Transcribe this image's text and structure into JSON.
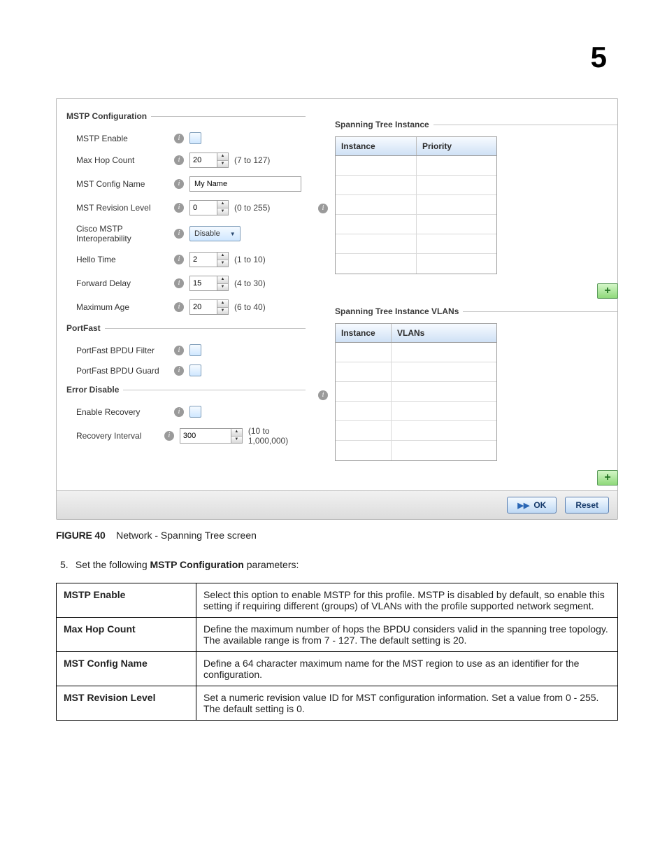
{
  "chapter_number": "5",
  "mstp_config": {
    "title": "MSTP Configuration",
    "rows": {
      "mstp_enable": {
        "label": "MSTP Enable"
      },
      "max_hop": {
        "label": "Max Hop Count",
        "value": "20",
        "hint": "(7 to 127)"
      },
      "config_name": {
        "label": "MST Config Name",
        "value": "My Name"
      },
      "rev_level": {
        "label": "MST Revision Level",
        "value": "0",
        "hint": "(0 to 255)"
      },
      "cisco": {
        "label": "Cisco MSTP Interoperability",
        "value": "Disable"
      },
      "hello": {
        "label": "Hello Time",
        "value": "2",
        "hint": "(1 to 10)"
      },
      "fwd_delay": {
        "label": "Forward Delay",
        "value": "15",
        "hint": "(4 to 30)"
      },
      "max_age": {
        "label": "Maximum Age",
        "value": "20",
        "hint": "(6 to 40)"
      }
    }
  },
  "portfast": {
    "title": "PortFast",
    "filter": {
      "label": "PortFast BPDU Filter"
    },
    "guard": {
      "label": "PortFast BPDU Guard"
    }
  },
  "error_disable": {
    "title": "Error Disable",
    "enable_recovery": {
      "label": "Enable Recovery"
    },
    "recovery_interval": {
      "label": "Recovery Interval",
      "value": "300",
      "hint": "(10 to 1,000,000)"
    }
  },
  "sti": {
    "title": "Spanning Tree Instance",
    "col_instance": "Instance",
    "col_priority": "Priority"
  },
  "stiv": {
    "title": "Spanning Tree Instance VLANs",
    "col_instance": "Instance",
    "col_vlans": "VLANs"
  },
  "buttons": {
    "ok": "OK",
    "reset": "Reset"
  },
  "figure": {
    "label": "FIGURE 40",
    "caption": "Network - Spanning Tree screen"
  },
  "step5": {
    "num": "5.",
    "before": "Set the following ",
    "bold": "MSTP Configuration",
    "after": " parameters:"
  },
  "param_table": {
    "r1": {
      "name": "MSTP Enable",
      "desc": "Select this option to enable MSTP for this profile. MSTP is disabled by default, so enable this setting if requiring different (groups) of VLANs with the profile supported network segment."
    },
    "r2": {
      "name": "Max Hop Count",
      "desc": "Define the maximum number of hops the BPDU considers valid in the spanning tree topology. The available range is from 7 - 127. The default setting is 20."
    },
    "r3": {
      "name": "MST Config Name",
      "desc": "Define a 64 character maximum name for the MST region to use as an identifier for the configuration."
    },
    "r4": {
      "name": "MST Revision Level",
      "desc": "Set a numeric revision value ID for MST configuration information. Set a value from 0 - 255. The default setting is 0."
    }
  }
}
